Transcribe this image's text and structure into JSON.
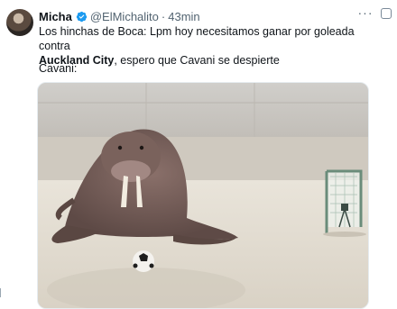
{
  "tweet": {
    "author_name": "Micha",
    "handle": "@ElMichalito",
    "separator": "·",
    "time": "43min",
    "more_label": "···",
    "text_line1": "Los hinchas de Boca: Lpm hoy necesitamos ganar por goleada contra",
    "text_bold": "Auckland City",
    "text_line2_rest": ", espero que Cavani se despierte",
    "caption": "Cavani:"
  },
  "colors": {
    "verified": "#1d9bf0",
    "secondary_text": "#536471"
  },
  "icons": {
    "verified": "verified-badge-icon",
    "more": "more-options-icon",
    "side": "expand-icon"
  }
}
